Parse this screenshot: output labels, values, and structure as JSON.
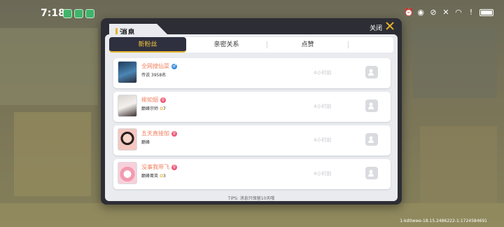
{
  "status_bar": {
    "time": "7:18"
  },
  "dialog": {
    "title": "消息",
    "close_label": "关闭",
    "tabs": [
      {
        "label": "新粉丝",
        "active": true
      },
      {
        "label": "亲密关系",
        "active": false
      },
      {
        "label": "点赞",
        "active": false
      }
    ],
    "rows": [
      {
        "name": "全网搜仙菜",
        "gender": "male",
        "rank": "传说 3958名",
        "time": "4小时前"
      },
      {
        "name": "柳如烟",
        "gender": "female",
        "rank": "巅峰宗师",
        "stars": "7",
        "time": "4小时前"
      },
      {
        "name": "五天直接加",
        "gender": "female",
        "rank": "巅峰",
        "time": "4小时前"
      },
      {
        "name": "没事我带飞",
        "gender": "female",
        "rank": "巅峰菁英",
        "stars": "3",
        "time": "4小时前"
      }
    ],
    "tips": "TIPS: 消息只保留10天哦"
  },
  "watermark": "1-kd0wwe-18.15.2486222-1:1724584691",
  "colors": {
    "accent": "#e5b32a",
    "name": "#f07f5d",
    "tab_active_bg": "#2e3040"
  }
}
